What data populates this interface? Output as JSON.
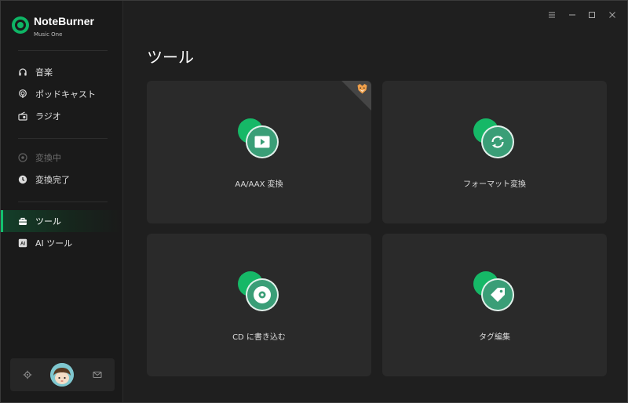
{
  "app": {
    "name": "NoteBurner",
    "subtitle": "Music One"
  },
  "sidebar": {
    "items": [
      {
        "label": "音楽",
        "icon": "headphones-icon"
      },
      {
        "label": "ポッドキャスト",
        "icon": "podcast-icon"
      },
      {
        "label": "ラジオ",
        "icon": "radio-icon"
      },
      {
        "label": "変換中",
        "icon": "converting-icon",
        "disabled": true
      },
      {
        "label": "変換完了",
        "icon": "clock-icon"
      },
      {
        "label": "ツール",
        "icon": "toolbox-icon",
        "active": true
      },
      {
        "label": "AI ツール",
        "icon": "ai-icon"
      }
    ],
    "bottom": [
      "settings-icon",
      "avatar",
      "mail-icon"
    ]
  },
  "window_controls": [
    "menu-icon",
    "minimize-icon",
    "maximize-icon",
    "close-icon"
  ],
  "main": {
    "title": "ツール",
    "tools": [
      {
        "label": "AA/AAX 変換",
        "icon": "play-icon"
      },
      {
        "label": "フォーマット変換",
        "icon": "refresh-icon"
      },
      {
        "label": "CD に書き込む",
        "icon": "cd-icon"
      },
      {
        "label": "タグ編集",
        "icon": "tag-icon"
      }
    ]
  },
  "colors": {
    "accent": "#13c06e",
    "sidebar_bg": "#1a1a1a",
    "main_bg": "#1f1f1f",
    "card_bg": "#2a2a2a"
  }
}
